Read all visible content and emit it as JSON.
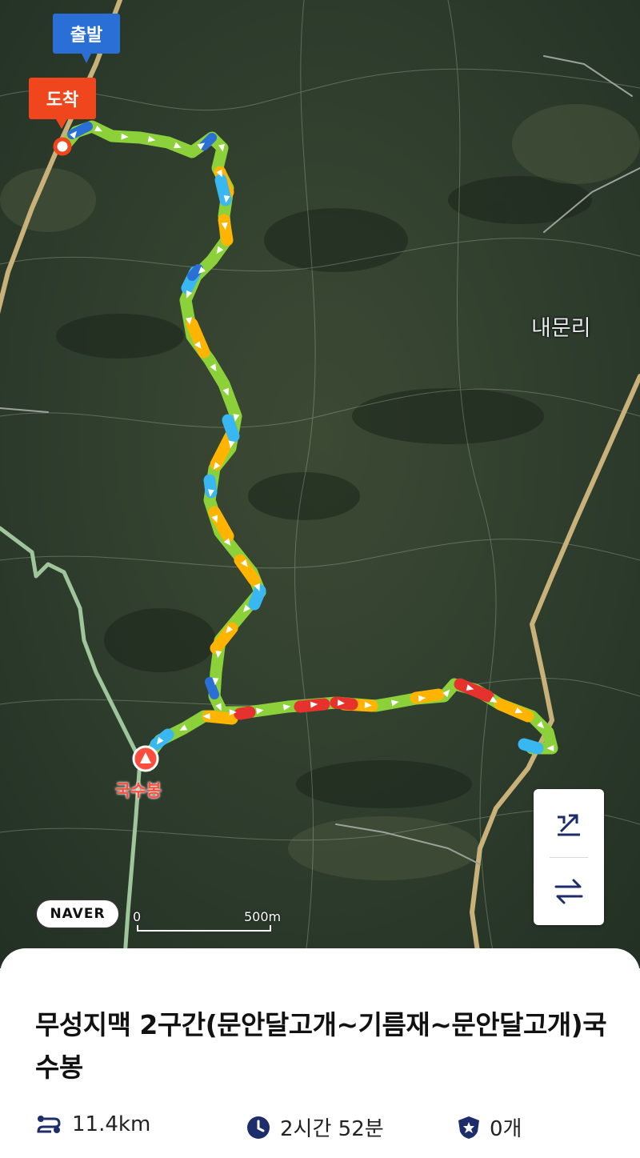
{
  "map": {
    "start_label": "출발",
    "end_label": "도착",
    "place_label": "내문리",
    "peak_label": "국수봉",
    "logo": "NAVER",
    "scale_zero": "0",
    "scale_distance": "500m",
    "route_colors": [
      "#8cd13a",
      "#ffb400",
      "#39b7f0",
      "#e5322d",
      "#2a6fd6"
    ]
  },
  "controls": {
    "fit_route_icon": "route-fit-icon",
    "reverse_icon": "swap-arrows-icon"
  },
  "course": {
    "title": "무성지맥 2구간(문안달고개~기름재~문안달고개)국수봉",
    "distance": "11.4km",
    "duration": "2시간 52분",
    "badges": "0개"
  }
}
